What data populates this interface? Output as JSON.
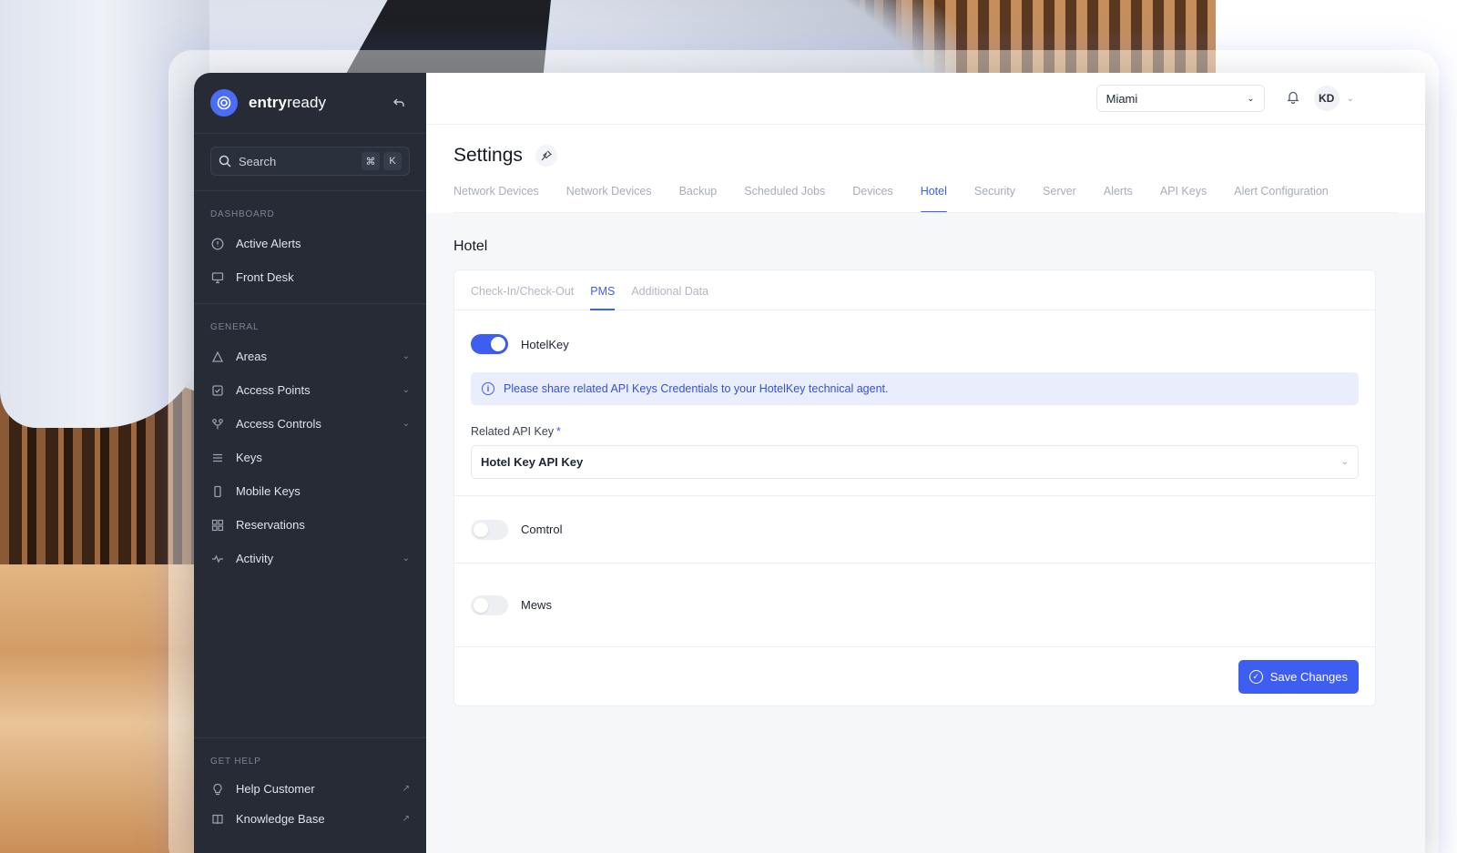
{
  "brand": {
    "name_bold": "entry",
    "name_regular": "ready"
  },
  "sidebar": {
    "search": {
      "label": "Search",
      "kbd1": "⌘",
      "kbd2": "K"
    },
    "dashboard": {
      "label": "DASHBOARD",
      "items": [
        {
          "label": "Active Alerts",
          "icon": "alert-circle-icon"
        },
        {
          "label": "Front Desk",
          "icon": "monitor-icon"
        }
      ]
    },
    "general": {
      "label": "GENERAL",
      "items": [
        {
          "label": "Areas",
          "icon": "areas-icon",
          "expandable": true
        },
        {
          "label": "Access Points",
          "icon": "access-point-icon",
          "expandable": true
        },
        {
          "label": "Access Controls",
          "icon": "access-control-icon",
          "expandable": true
        },
        {
          "label": "Keys",
          "icon": "keys-icon",
          "expandable": false
        },
        {
          "label": "Mobile Keys",
          "icon": "mobile-icon",
          "expandable": false
        },
        {
          "label": "Reservations",
          "icon": "grid-icon",
          "expandable": false
        },
        {
          "label": "Activity",
          "icon": "activity-icon",
          "expandable": true
        }
      ]
    },
    "help": {
      "label": "GET HELP",
      "items": [
        {
          "label": "Help Customer",
          "icon": "lightbulb-icon"
        },
        {
          "label": "Knowledge Base",
          "icon": "book-icon"
        }
      ]
    }
  },
  "topbar": {
    "location": "Miami",
    "avatar_initials": "KD"
  },
  "page": {
    "title": "Settings",
    "tabs": [
      {
        "label": "Network Devices",
        "active": false
      },
      {
        "label": "Network Devices",
        "active": false
      },
      {
        "label": "Backup",
        "active": false
      },
      {
        "label": "Scheduled Jobs",
        "active": false
      },
      {
        "label": "Devices",
        "active": false
      },
      {
        "label": "Hotel",
        "active": true
      },
      {
        "label": "Security",
        "active": false
      },
      {
        "label": "Server",
        "active": false
      },
      {
        "label": "Alerts",
        "active": false
      },
      {
        "label": "API Keys",
        "active": false
      },
      {
        "label": "Alert Configuration",
        "active": false
      }
    ]
  },
  "hotel": {
    "section_title": "Hotel",
    "subtabs": [
      {
        "label": "Check-In/Check-Out",
        "active": false
      },
      {
        "label": "PMS",
        "active": true
      },
      {
        "label": "Additional Data",
        "active": false
      }
    ],
    "hotelkey": {
      "label": "HotelKey",
      "enabled": true,
      "info": "Please share related API Keys Credentials to your HotelKey technical agent.",
      "field_label": "Related API Key",
      "field_required_mark": "*",
      "field_value": "Hotel Key API Key"
    },
    "comtrol": {
      "label": "Comtrol",
      "enabled": false
    },
    "mews": {
      "label": "Mews",
      "enabled": false
    },
    "save_label": "Save Changes"
  },
  "colors": {
    "accent": "#3d5ef0",
    "sidebar_bg": "#262b35"
  }
}
